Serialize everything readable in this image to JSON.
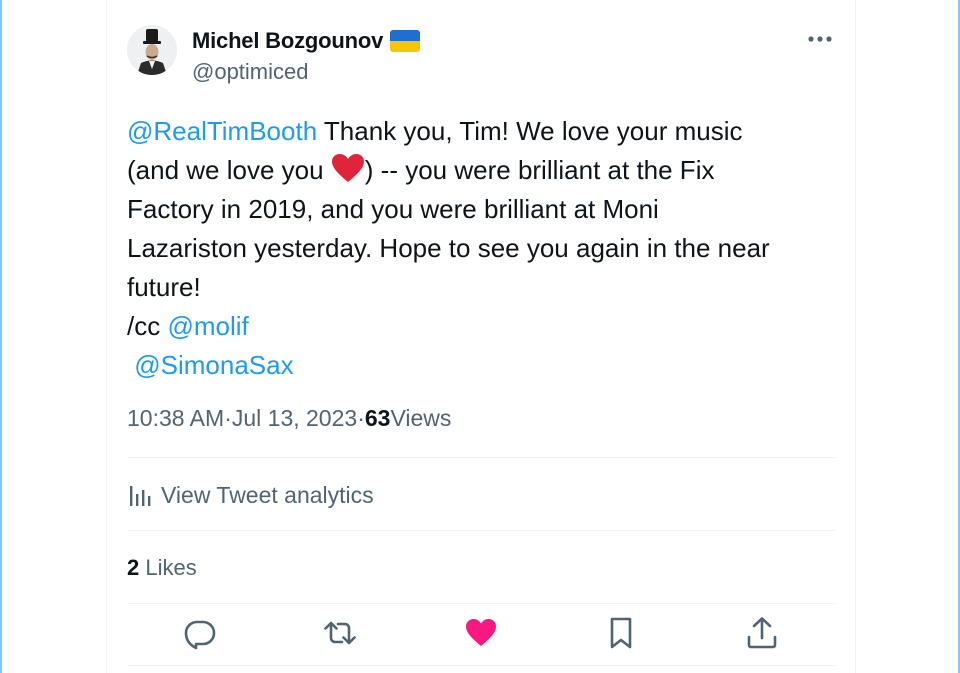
{
  "tweet": {
    "author": {
      "display_name": "Michel Bozgounov",
      "handle": "@optimiced",
      "flag_icon": "ukraine-flag-icon",
      "avatar": "avatar-man-top-hat"
    },
    "more_icon": "more-horizontal-icon",
    "text": {
      "mention_1": "@RealTimBooth",
      "part_1": " Thank you, Tim! We love your music",
      "part_2": "(and we love you ",
      "part_3": ") -- you were brilliant  at the Fix",
      "part_4": "Factory in 2019, and you were brilliant at Moni",
      "part_5": "Lazariston yesterday. Hope to see you again in the near",
      "part_6": "future!",
      "cc_prefix": "/cc ",
      "mention_2": "@molif",
      "mention_3": "@SimonaSax",
      "emoji": "red-heart-emoji"
    },
    "meta": {
      "time": "10:38 AM",
      "separator": " · ",
      "date": "Jul 13, 2023",
      "separator_2": " · ",
      "views_count": "63",
      "views_label": " Views"
    },
    "analytics": {
      "label": "View Tweet analytics",
      "icon": "analytics-bars-icon"
    },
    "likes": {
      "count": "2",
      "label": " Likes"
    },
    "actions": [
      {
        "name": "reply",
        "icon": "reply-bubble-icon"
      },
      {
        "name": "retweet",
        "icon": "retweet-icon"
      },
      {
        "name": "like",
        "icon": "heart-filled-icon",
        "active": true
      },
      {
        "name": "bookmark",
        "icon": "bookmark-icon"
      },
      {
        "name": "share",
        "icon": "share-upload-icon"
      }
    ],
    "colors": {
      "accent": "#1d9bf0",
      "like_active": "#f91880",
      "secondary_text": "#536471",
      "primary_text": "#0f1419",
      "divider": "#eff3f4"
    }
  }
}
